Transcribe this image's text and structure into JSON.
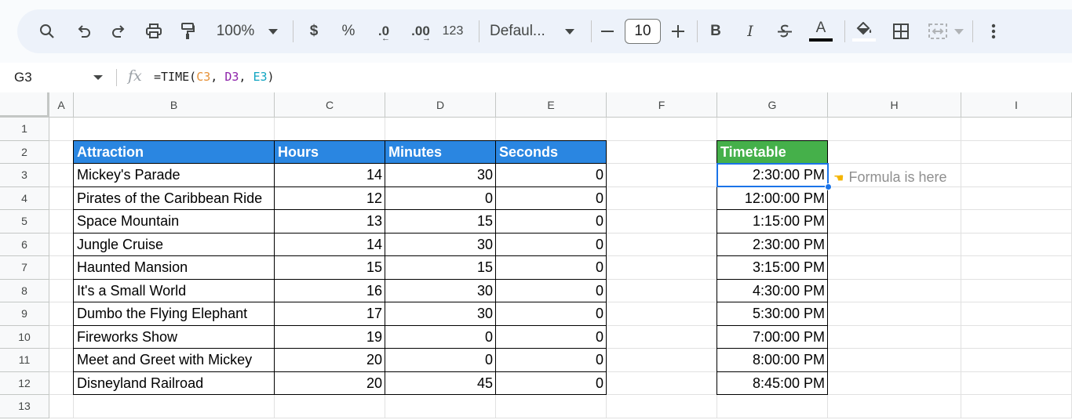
{
  "toolbar": {
    "zoom": "100%",
    "currency": "$",
    "percent": "%",
    "decrease_decimal": ".0",
    "increase_decimal": ".00",
    "number_format": "123",
    "font": "Defaul...",
    "font_size": "10",
    "bold": "B",
    "italic": "I",
    "text_color": "A"
  },
  "formula_bar": {
    "cell_ref": "G3",
    "fx": "fx",
    "formula_prefix": "=TIME(",
    "arg1": "C3",
    "sep1": ", ",
    "arg2": "D3",
    "sep2": ", ",
    "arg3": "E3",
    "formula_suffix": ")"
  },
  "columns": [
    "A",
    "B",
    "C",
    "D",
    "E",
    "F",
    "G",
    "H",
    "I"
  ],
  "rows": [
    "1",
    "2",
    "3",
    "4",
    "5",
    "6",
    "7",
    "8",
    "9",
    "10",
    "11",
    "12",
    "13"
  ],
  "table": {
    "headers": {
      "attraction": "Attraction",
      "hours": "Hours",
      "minutes": "Minutes",
      "seconds": "Seconds",
      "timetable": "Timetable"
    },
    "rows": [
      {
        "attraction": "Mickey's Parade",
        "hours": "14",
        "minutes": "30",
        "seconds": "0",
        "time": "2:30:00 PM"
      },
      {
        "attraction": "Pirates of the Caribbean Ride",
        "hours": "12",
        "minutes": "0",
        "seconds": "0",
        "time": "12:00:00 PM"
      },
      {
        "attraction": "Space Mountain",
        "hours": "13",
        "minutes": "15",
        "seconds": "0",
        "time": "1:15:00 PM"
      },
      {
        "attraction": "Jungle Cruise",
        "hours": "14",
        "minutes": "30",
        "seconds": "0",
        "time": "2:30:00 PM"
      },
      {
        "attraction": "Haunted Mansion",
        "hours": "15",
        "minutes": "15",
        "seconds": "0",
        "time": "3:15:00 PM"
      },
      {
        "attraction": "It's a Small World",
        "hours": "16",
        "minutes": "30",
        "seconds": "0",
        "time": "4:30:00 PM"
      },
      {
        "attraction": "Dumbo the Flying Elephant",
        "hours": "17",
        "minutes": "30",
        "seconds": "0",
        "time": "5:30:00 PM"
      },
      {
        "attraction": "Fireworks Show",
        "hours": "19",
        "minutes": "0",
        "seconds": "0",
        "time": "7:00:00 PM"
      },
      {
        "attraction": "Meet and Greet with Mickey",
        "hours": "20",
        "minutes": "0",
        "seconds": "0",
        "time": "8:00:00 PM"
      },
      {
        "attraction": "Disneyland Railroad",
        "hours": "20",
        "minutes": "45",
        "seconds": "0",
        "time": "8:45:00 PM"
      }
    ]
  },
  "note": {
    "icon": "pointing-hand-icon",
    "text": "Formula is here"
  },
  "colors": {
    "header_blue": "#2a86e1",
    "header_green": "#45b04a",
    "selection": "#1a73e8"
  }
}
